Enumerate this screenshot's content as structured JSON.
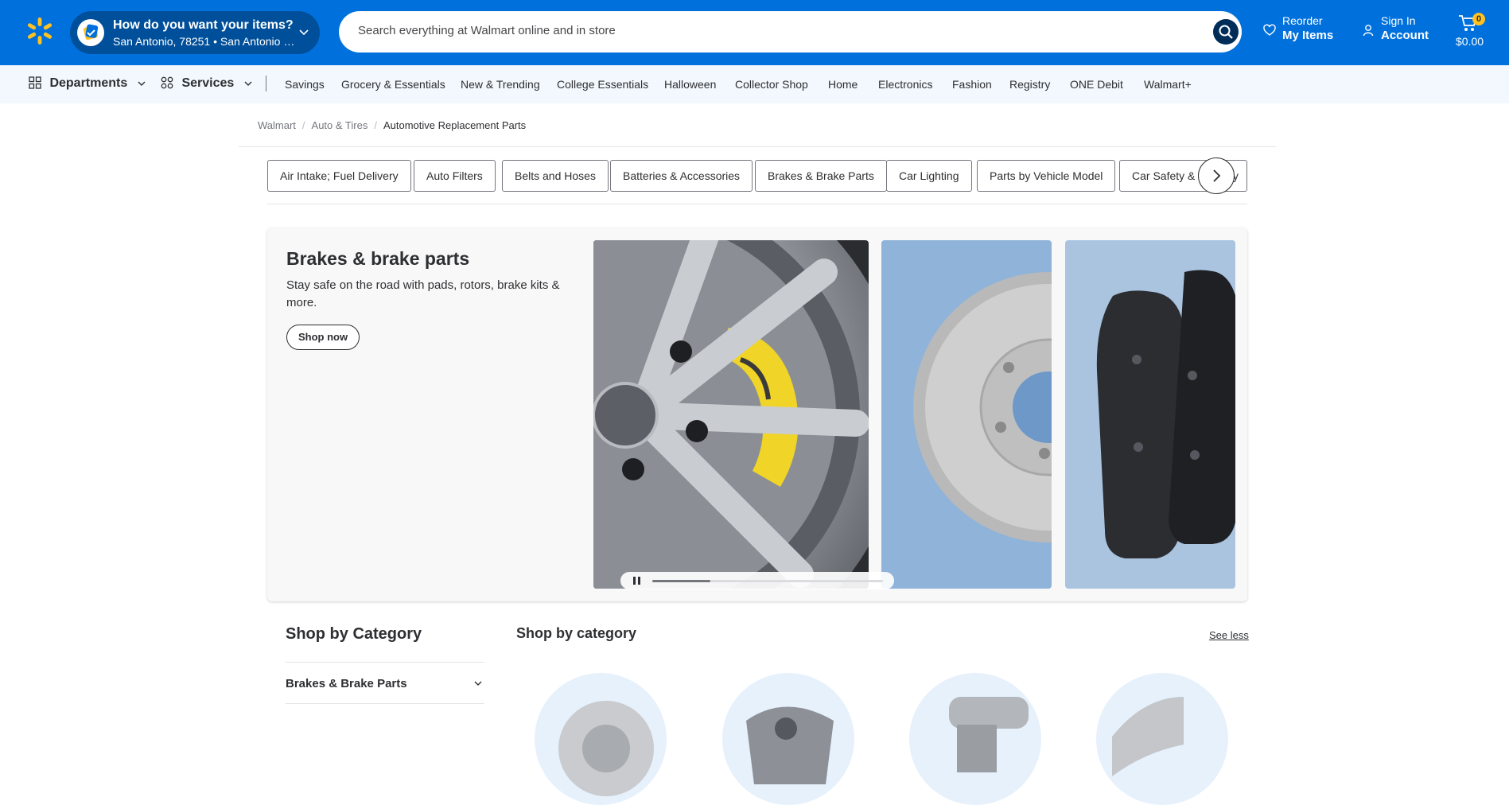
{
  "header": {
    "fulfillment": {
      "title": "How do you want your items?",
      "location": "San Antonio, 78251 • San Antonio Su..."
    },
    "search": {
      "placeholder": "Search everything at Walmart online and in store"
    },
    "reorder": {
      "line1": "Reorder",
      "line2": "My Items"
    },
    "account": {
      "line1": "Sign In",
      "line2": "Account"
    },
    "cart": {
      "count": "0",
      "total": "$0.00"
    },
    "colors": {
      "brand_blue": "#0071dc",
      "dark_blue": "#004f9a",
      "spark_yellow": "#ffc220"
    }
  },
  "nav": {
    "departments": "Departments",
    "services": "Services",
    "items": [
      "Savings",
      "Grocery & Essentials",
      "New & Trending",
      "College Essentials",
      "Halloween",
      "Collector Shop",
      "Home",
      "Electronics",
      "Fashion",
      "Registry",
      "ONE Debit",
      "Walmart+"
    ]
  },
  "breadcrumb": [
    "Walmart",
    "Auto & Tires",
    "Automotive Replacement Parts"
  ],
  "category_pills": [
    "Air Intake; Fuel Delivery",
    "Auto Filters",
    "Belts and Hoses",
    "Batteries & Accessories",
    "Brakes & Brake Parts",
    "Car Lighting",
    "Parts by Vehicle Model",
    "Car Safety & Security"
  ],
  "hero": {
    "title": "Brakes & brake parts",
    "description": "Stay safe on the road with pads, rotors, brake kits & more.",
    "cta": "Shop now",
    "slide_progress": 0.25
  },
  "shop_by_category": {
    "sidebar_title": "Shop by Category",
    "sidebar_items": [
      "Brakes & Brake Parts"
    ],
    "main_title": "Shop by category",
    "see_less": "See less"
  }
}
